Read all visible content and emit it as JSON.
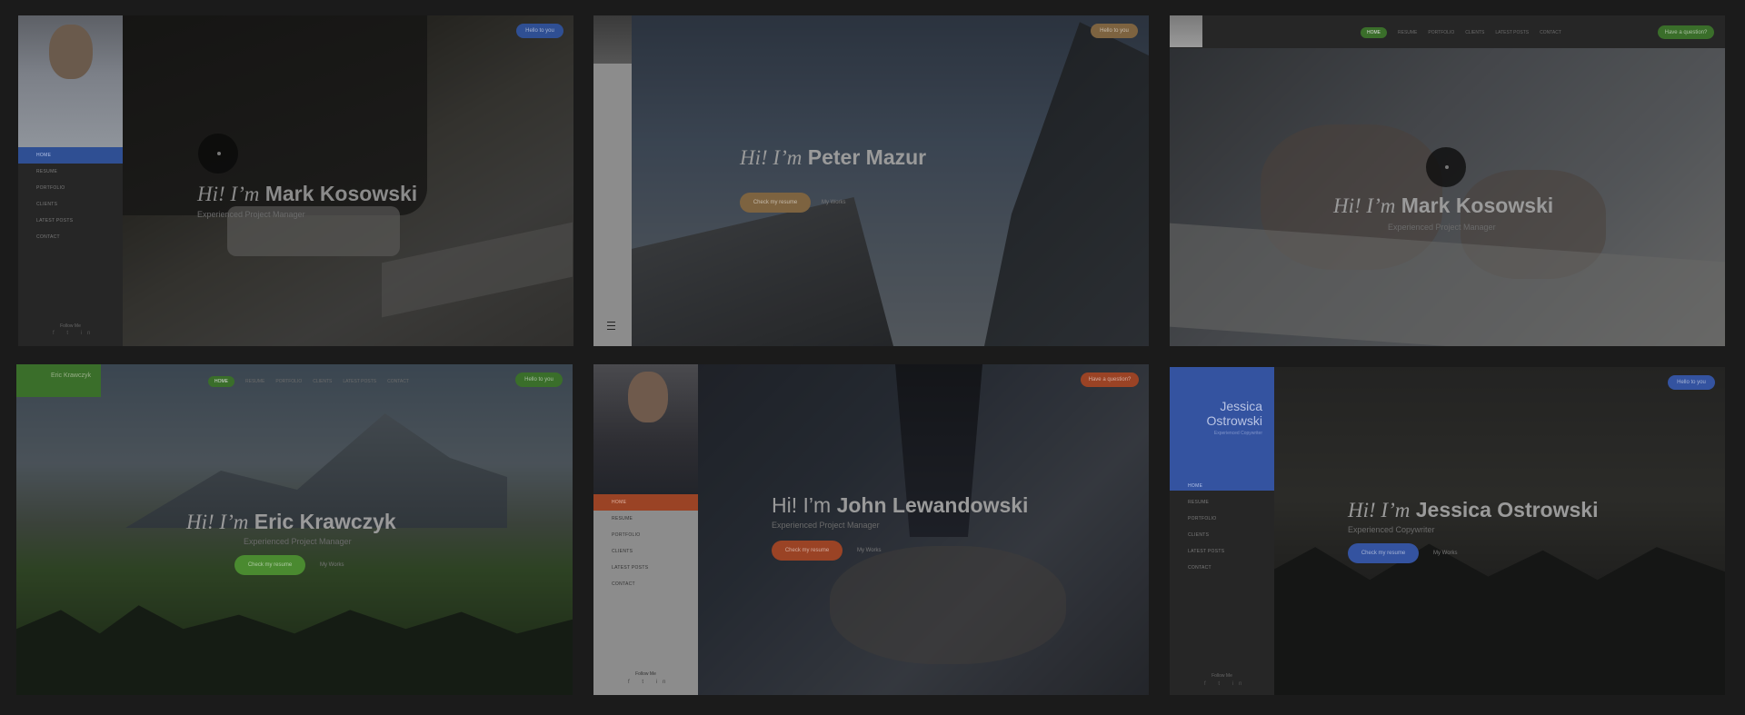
{
  "tiles": [
    {
      "title_hi": "Hi! I’m",
      "title_name": "Mark Kosowski",
      "subtitle": "Experienced Project Manager",
      "cta_label": "Hello to you",
      "nav": [
        "Home",
        "Resume",
        "Portfolio",
        "Clients",
        "Latest Posts",
        "Contact"
      ],
      "follow_label": "Follow Me"
    },
    {
      "title_hi": "Hi! I’m",
      "title_name": "Peter Mazur",
      "primary_button": "Check my resume",
      "secondary_link": "My Works",
      "cta_label": "Hello to you"
    },
    {
      "title_hi": "Hi! I’m",
      "title_name": "Mark Kosowski",
      "subtitle": "Experienced Project Manager",
      "nav": [
        "Home",
        "Resume",
        "Portfolio",
        "Clients",
        "Latest Posts",
        "Contact"
      ],
      "cta_label": "Have a question?"
    },
    {
      "brand": "Eric Krawczyk",
      "title_hi": "Hi! I’m",
      "title_name": "Eric Krawczyk",
      "subtitle": "Experienced Project Manager",
      "primary_button": "Check my resume",
      "secondary_link": "My Works",
      "nav": [
        "Home",
        "Resume",
        "Portfolio",
        "Clients",
        "Latest Posts",
        "Contact"
      ],
      "cta_label": "Hello to you"
    },
    {
      "title_hi": "Hi! I’m",
      "title_name": "John Lewandowski",
      "subtitle": "Experienced Project Manager",
      "primary_button": "Check my resume",
      "secondary_link": "My Works",
      "nav": [
        "Home",
        "Resume",
        "Portfolio",
        "Clients",
        "Latest Posts",
        "Contact"
      ],
      "follow_label": "Follow Me",
      "cta_label": "Have a question?"
    },
    {
      "brand_line1": "Jessica",
      "brand_line2": "Ostrowski",
      "brand_sub": "Experienced Copywriter",
      "title_hi": "Hi! I’m",
      "title_name": "Jessica Ostrowski",
      "subtitle": "Experienced Copywriter",
      "primary_button": "Check my resume",
      "secondary_link": "My Works",
      "nav": [
        "Home",
        "Resume",
        "Portfolio",
        "Clients",
        "Latest Posts",
        "Contact"
      ],
      "follow_label": "Follow Me",
      "cta_label": "Hello to you"
    }
  ],
  "social_icons": "f t in",
  "colors": {
    "page_bg": "#1b1b1b",
    "blue": "#3c5fb4",
    "green": "#4f9a32",
    "orange": "#b9542f",
    "tan": "#8a6a3c"
  }
}
